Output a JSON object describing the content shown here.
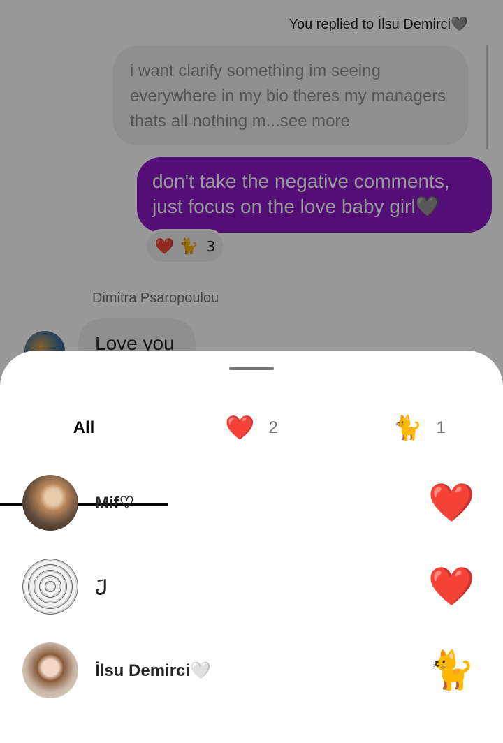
{
  "chat": {
    "reply_context": "You replied to İlsu Demirci",
    "reply_context_emoji": "🩶",
    "quoted_message": "i want clarify something im seeing everywhere in my bio theres my managers thats all nothing m...see more",
    "my_message": "don't take the negative comments, just focus on the love baby girl🩶",
    "message_reactions": {
      "emojis": "❤️ 🐈",
      "count": "3"
    },
    "sender_name": "Dimitra Psaropoulou",
    "their_message": "Love you"
  },
  "sheet": {
    "tabs": [
      {
        "label": "All",
        "selected": true
      },
      {
        "emoji": "❤️",
        "count": "2"
      },
      {
        "emoji": "🐈",
        "count": "1"
      }
    ],
    "reactors": [
      {
        "name": "Mif♡",
        "reaction": "❤️"
      },
      {
        "name": "لَ",
        "reaction": "❤️"
      },
      {
        "name": "İlsu Demirci🤍",
        "reaction": "🐈"
      }
    ]
  },
  "colors": {
    "accent": "#8a19c4",
    "overlay": "rgba(0,0,0,0.40)"
  }
}
